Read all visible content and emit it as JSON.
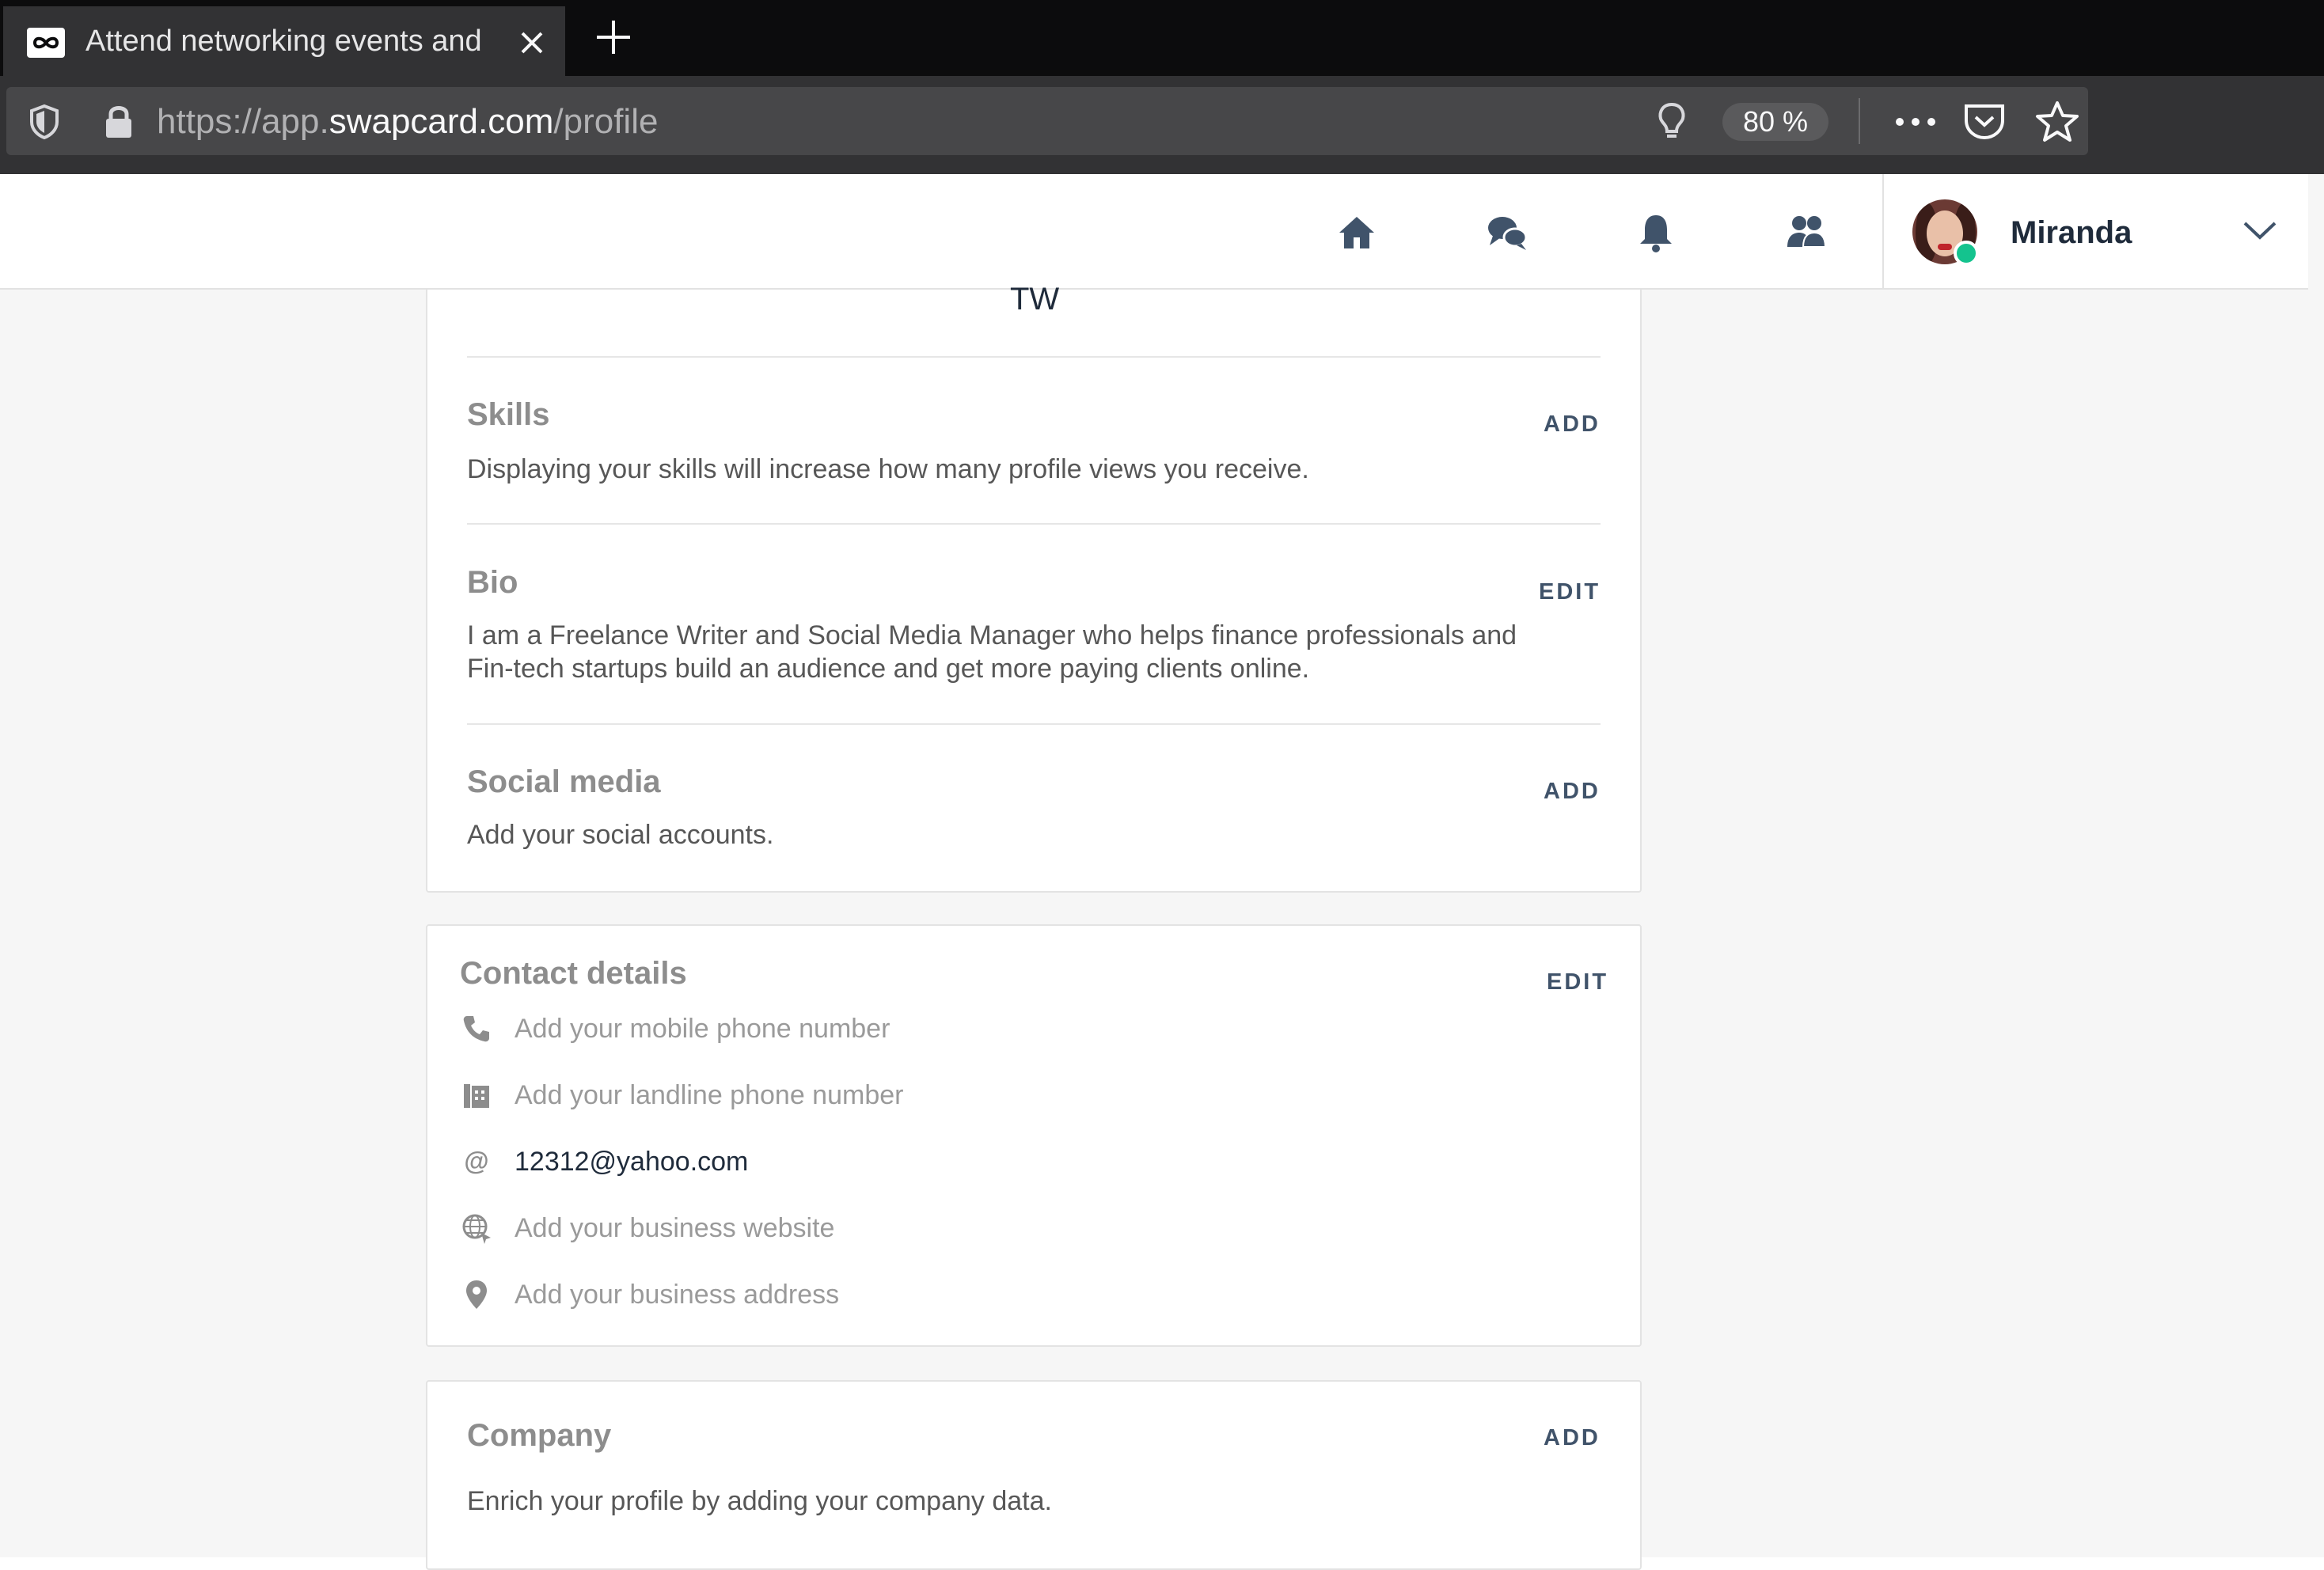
{
  "browser": {
    "tab_title": "Attend networking events and",
    "url_scheme": "https://app.",
    "url_host": "swapcard.com",
    "url_path": "/profile",
    "zoom": "80 %"
  },
  "header": {
    "nav_icons": [
      "home-icon",
      "chat-icon",
      "bell-icon",
      "contacts-icon"
    ],
    "username": "Miranda",
    "online_color": "#14c38e"
  },
  "profile": {
    "initials": "TW",
    "skills": {
      "title": "Skills",
      "action": "ADD",
      "text": "Displaying your skills will increase how many profile views you receive."
    },
    "bio": {
      "title": "Bio",
      "action": "EDIT",
      "line1": "I am a Freelance Writer and Social Media Manager who helps finance professionals and",
      "line2": "Fin-tech startups build an audience and get more paying clients online."
    },
    "social": {
      "title": "Social media",
      "action": "ADD",
      "text": "Add your social accounts."
    }
  },
  "contact": {
    "title": "Contact details",
    "action": "EDIT",
    "mobile": "Add your mobile phone number",
    "landline": "Add your landline phone number",
    "email": "12312@yahoo.com",
    "website": "Add your business website",
    "address": "Add your business address"
  },
  "company": {
    "title": "Company",
    "action": "ADD",
    "text": "Enrich your profile by adding your company data."
  },
  "colors": {
    "accent": "#40536a",
    "section_title": "#8d8d8d"
  }
}
